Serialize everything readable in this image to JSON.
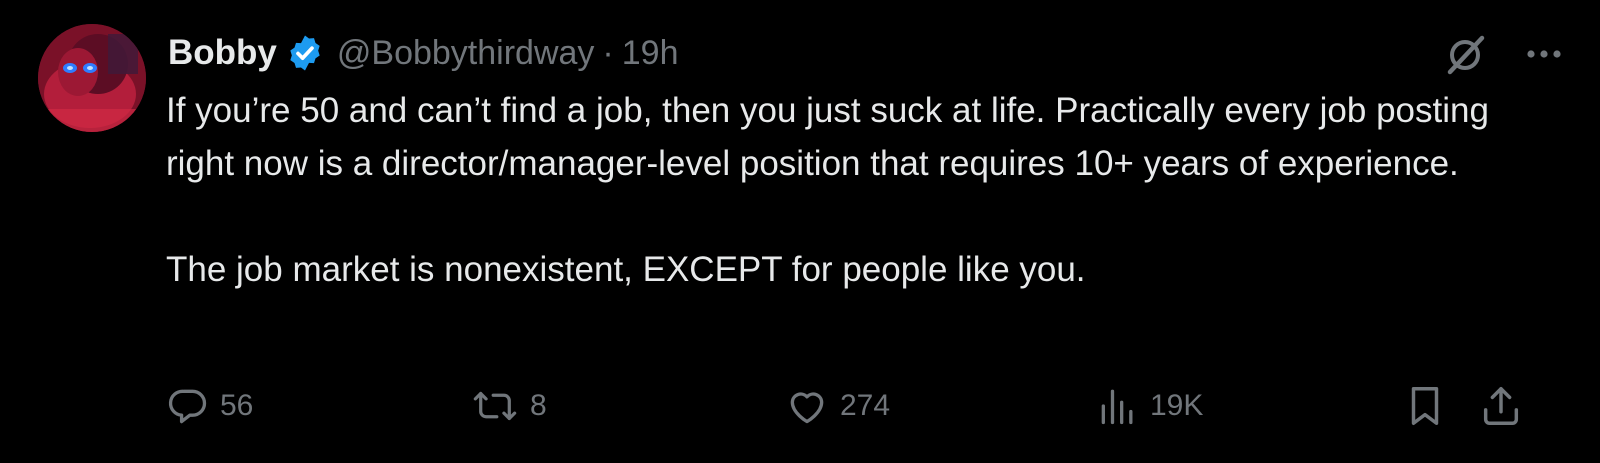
{
  "author": {
    "name": "Bobby",
    "handle": "@Bobbythirdway",
    "separator": "·",
    "time": "19h",
    "verified": true
  },
  "tweet": {
    "paragraphs": [
      "If you’re 50 and can’t find a job, then you just suck at life. Practically every job posting right now is a director/manager-level position that requires 10+ years of experience.",
      "The job market is nonexistent, EXCEPT for people like you."
    ]
  },
  "metrics": {
    "replies": "56",
    "reposts": "8",
    "likes": "274",
    "views": "19K"
  },
  "icons": {
    "verified": "verified-badge-icon",
    "grok": "grok-icon",
    "more": "more-options-icon",
    "reply": "reply-icon",
    "repost": "repost-icon",
    "like": "heart-icon",
    "views": "views-chart-icon",
    "bookmark": "bookmark-icon",
    "share": "share-icon"
  },
  "colors": {
    "background": "#000000",
    "text_primary": "#e7e9ea",
    "text_secondary": "#71767b",
    "verified_blue": "#1d9bf0"
  }
}
